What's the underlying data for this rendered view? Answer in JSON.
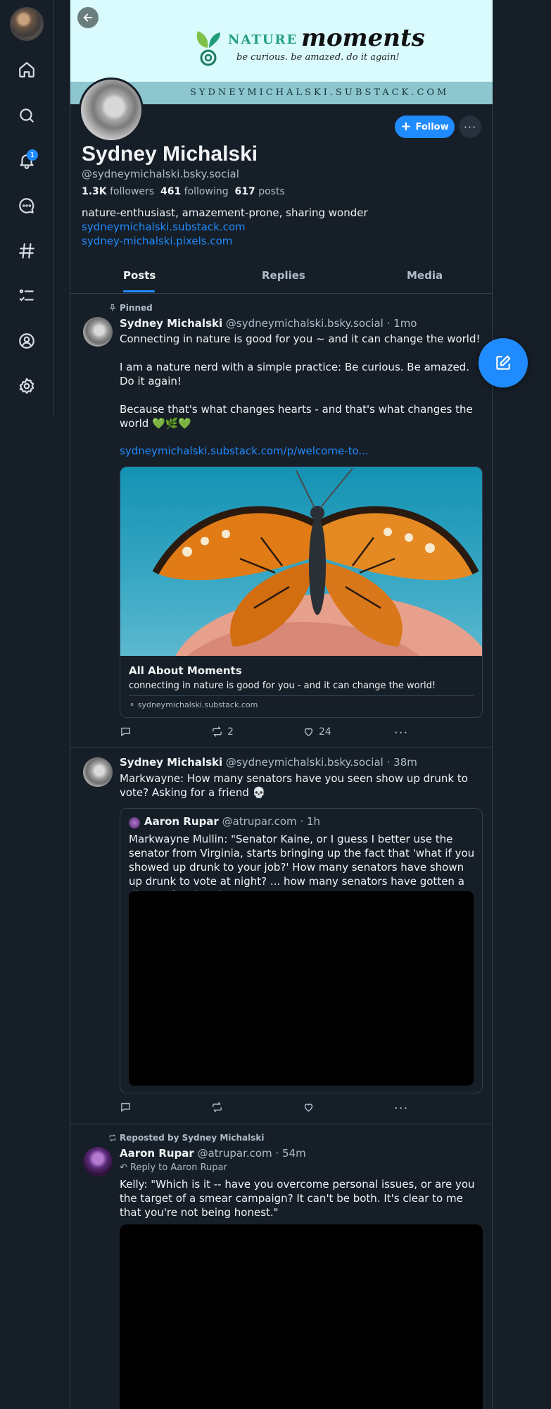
{
  "nav": {
    "items": [
      {
        "name": "home-icon"
      },
      {
        "name": "search-icon"
      },
      {
        "name": "bell-icon"
      },
      {
        "name": "chat-icon"
      },
      {
        "name": "hashtag-icon"
      },
      {
        "name": "list-icon"
      },
      {
        "name": "profile-icon"
      },
      {
        "name": "settings-icon"
      }
    ],
    "notification_count": "1"
  },
  "banner": {
    "logo_nature": "NATURE",
    "logo_moments": "moments",
    "tagline": "be curious. be amazed. do it again!",
    "site": "SYDNEYMICHALSKI.SUBSTACK.COM"
  },
  "profile": {
    "display_name": "Sydney Michalski",
    "handle": "@sydneymichalski.bsky.social",
    "followers_count": "1.3K",
    "followers_label": "followers",
    "following_count": "461",
    "following_label": "following",
    "posts_count": "617",
    "posts_label": "posts",
    "bio": "nature-enthusiast, amazement-prone, sharing wonder",
    "link1": "sydneymichalski.substack.com",
    "link2": "sydney-michalski.pixels.com",
    "follow_label": "Follow",
    "more_label": "···"
  },
  "tabs": [
    "Posts",
    "Replies",
    "Media"
  ],
  "posts": [
    {
      "pinned_label": "Pinned",
      "author": "Sydney Michalski",
      "handle": "@sydneymichalski.bsky.social",
      "time": "· 1mo",
      "text": "Connecting in nature is good for you ~ and it can change the world!\n\nI am a nature nerd with a simple practice: Be curious. Be amazed. Do it again!\n\nBecause that's what changes hearts - and that's what changes the world 💚🌿💚",
      "link": "sydneymichalski.substack.com/p/welcome-to...",
      "card_title": "All About Moments",
      "card_desc": "connecting in nature is good for you - and it can change the world!",
      "card_domain": "sydneymichalski.substack.com",
      "reposts": "2",
      "likes": "24"
    },
    {
      "author": "Sydney Michalski",
      "handle": "@sydneymichalski.bsky.social",
      "time": "· 38m",
      "text": "Markwayne: How many senators have you seen show up drunk to vote? Asking for a friend 💀",
      "quote_author": "Aaron Rupar",
      "quote_handle": "@atrupar.com",
      "quote_time": "· 1h",
      "quote_text": "Markwayne Mullin: \"Senator Kaine, or I guess I better use the senator from Virginia, starts bringing up the fact that 'what if you showed up drunk to your job?' How many senators have shown up drunk to vote at night? ... how many senators have gotten a divorce for cheating?\""
    },
    {
      "repost_label": "Reposted by Sydney Michalski",
      "author": "Aaron Rupar",
      "handle": "@atrupar.com",
      "time": "· 54m",
      "reply_to": "Reply to Aaron Rupar",
      "text": "Kelly: \"Which is it -- have you overcome personal issues, or are you the target of a smear campaign? It can't be both. It's clear to me that you're not being honest.\""
    }
  ],
  "colors": {
    "accent": "#208bfe",
    "background": "#161e27",
    "border": "#2e4052",
    "banner_bg": "#d9fbfd"
  }
}
